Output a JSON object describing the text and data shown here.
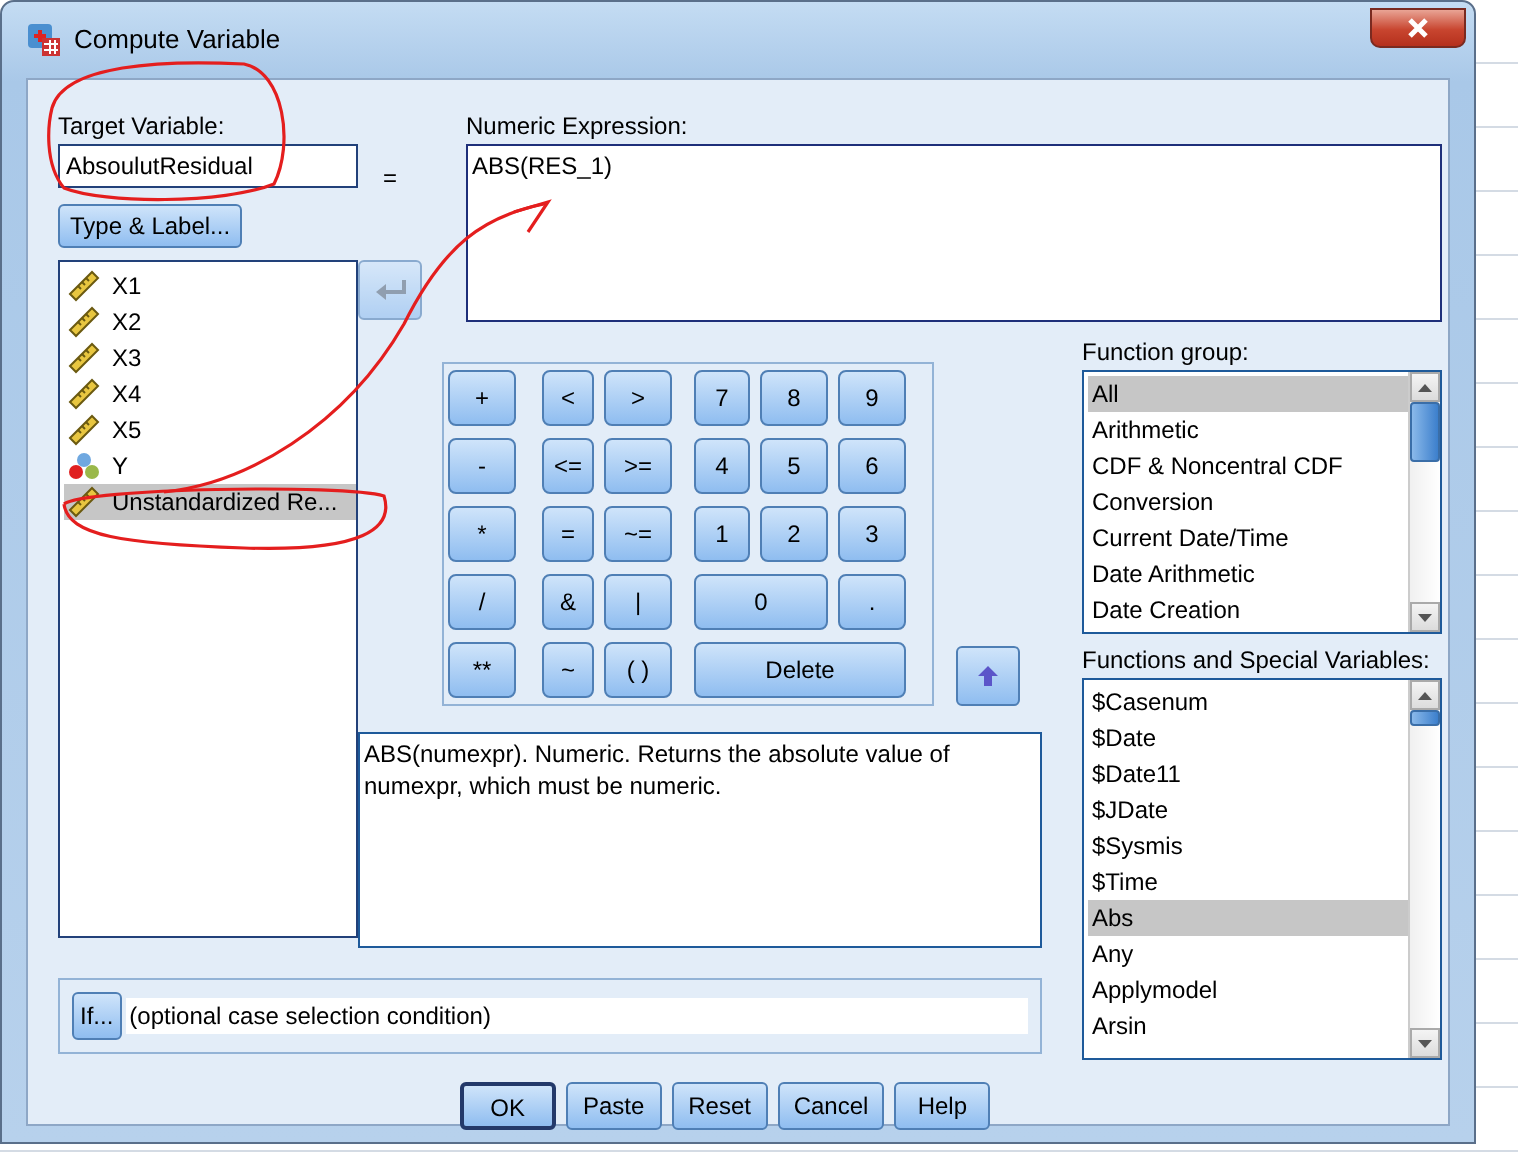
{
  "window": {
    "title": "Compute Variable"
  },
  "target_variable": {
    "label": "Target Variable:",
    "value": "AbsoulutResidual"
  },
  "equals": "=",
  "type_label_button": "Type & Label...",
  "variables": [
    {
      "name": "X1",
      "kind": "scale",
      "selected": false
    },
    {
      "name": "X2",
      "kind": "scale",
      "selected": false
    },
    {
      "name": "X3",
      "kind": "scale",
      "selected": false
    },
    {
      "name": "X4",
      "kind": "scale",
      "selected": false
    },
    {
      "name": "X5",
      "kind": "scale",
      "selected": false
    },
    {
      "name": "Y",
      "kind": "nominal",
      "selected": false
    },
    {
      "name": "Unstandardized Re...",
      "kind": "scale",
      "selected": true
    }
  ],
  "numeric_expression": {
    "label": "Numeric Expression:",
    "value": "ABS(RES_1)"
  },
  "keypad": {
    "rows": [
      [
        "+",
        "<",
        ">",
        "7",
        "8",
        "9"
      ],
      [
        "-",
        "<=",
        ">=",
        "4",
        "5",
        "6"
      ],
      [
        "*",
        "=",
        "~=",
        "1",
        "2",
        "3"
      ],
      [
        "/",
        "&",
        "|",
        {
          "text": "0",
          "colspan": 2
        },
        "."
      ],
      [
        "**",
        "~",
        "( )",
        {
          "text": "Delete",
          "colspan": 3
        }
      ]
    ]
  },
  "description": "ABS(numexpr). Numeric. Returns the absolute value of numexpr, which must be numeric.",
  "function_group": {
    "label": "Function group:",
    "items": [
      {
        "name": "All",
        "selected": true
      },
      {
        "name": "Arithmetic",
        "selected": false
      },
      {
        "name": "CDF & Noncentral CDF",
        "selected": false
      },
      {
        "name": "Conversion",
        "selected": false
      },
      {
        "name": "Current Date/Time",
        "selected": false
      },
      {
        "name": "Date Arithmetic",
        "selected": false
      },
      {
        "name": "Date Creation",
        "selected": false
      }
    ]
  },
  "functions": {
    "label": "Functions and Special Variables:",
    "items": [
      {
        "name": "$Casenum",
        "selected": false
      },
      {
        "name": "$Date",
        "selected": false
      },
      {
        "name": "$Date11",
        "selected": false
      },
      {
        "name": "$JDate",
        "selected": false
      },
      {
        "name": "$Sysmis",
        "selected": false
      },
      {
        "name": "$Time",
        "selected": false
      },
      {
        "name": "Abs",
        "selected": true
      },
      {
        "name": "Any",
        "selected": false
      },
      {
        "name": "Applymodel",
        "selected": false
      },
      {
        "name": "Arsin",
        "selected": false
      }
    ]
  },
  "if_button": "If...",
  "if_condition": "(optional case selection condition)",
  "buttons": [
    {
      "label": "OK",
      "default": true
    },
    {
      "label": "Paste",
      "default": false
    },
    {
      "label": "Reset",
      "default": false
    },
    {
      "label": "Cancel",
      "default": false
    },
    {
      "label": "Help",
      "default": false
    }
  ]
}
